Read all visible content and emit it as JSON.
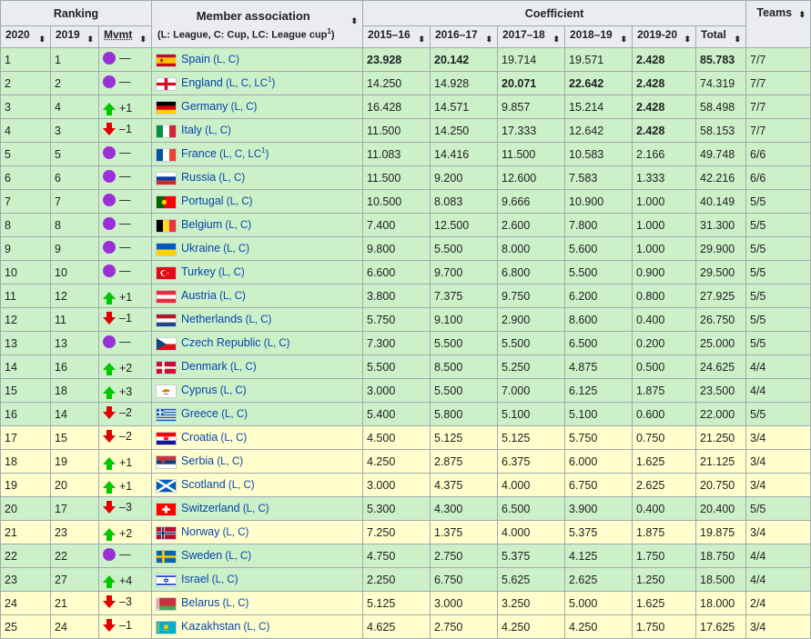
{
  "header": {
    "ranking": "Ranking",
    "member": "Member association",
    "member_sub": "(L: League, C: Cup, LC: League cup",
    "member_sub_sup": "1",
    "member_sub_end": ")",
    "coefficient": "Coefficient",
    "teams": "Teams",
    "col_2020": "2020",
    "col_2019": "2019",
    "col_mvmt": "Mvmt",
    "col_1516": "2015–16",
    "col_1617": "2016–17",
    "col_1718": "2017–18",
    "col_1819": "2018–19",
    "col_1920": "2019-20",
    "col_total": "Total",
    "sort_glyph": "⬍"
  },
  "colors": {
    "green_row": "#ccf0c8",
    "yellow_row": "#fffecc",
    "header_bg": "#eaecf0",
    "link": "#0645ad",
    "up": "#00c800",
    "down": "#e00000",
    "same": "#9b30d9"
  },
  "rows": [
    {
      "r2020": "1",
      "r2019": "1",
      "mv": "same",
      "mvt": "—",
      "flag": "spain",
      "country": "Spain",
      "comp": "(L, C)",
      "sup": "",
      "comp2": "",
      "v1": "23.928",
      "b1": true,
      "v2": "20.142",
      "b2": true,
      "v3": "19.714",
      "b3": false,
      "v4": "19.571",
      "b4": false,
      "v5": "2.428",
      "b5": true,
      "total": "85.783",
      "bt": true,
      "teams": "7/7",
      "color": "green"
    },
    {
      "r2020": "2",
      "r2019": "2",
      "mv": "same",
      "mvt": "—",
      "flag": "england",
      "country": "England",
      "comp": "(L, C, LC",
      "sup": "1",
      "comp2": ")",
      "v1": "14.250",
      "b1": false,
      "v2": "14.928",
      "b2": false,
      "v3": "20.071",
      "b3": true,
      "v4": "22.642",
      "b4": true,
      "v5": "2.428",
      "b5": true,
      "total": "74.319",
      "bt": false,
      "teams": "7/7",
      "color": "green"
    },
    {
      "r2020": "3",
      "r2019": "4",
      "mv": "up",
      "mvt": "+1",
      "flag": "germany",
      "country": "Germany",
      "comp": "(L, C)",
      "sup": "",
      "comp2": "",
      "v1": "16.428",
      "b1": false,
      "v2": "14.571",
      "b2": false,
      "v3": "9.857",
      "b3": false,
      "v4": "15.214",
      "b4": false,
      "v5": "2.428",
      "b5": true,
      "total": "58.498",
      "bt": false,
      "teams": "7/7",
      "color": "green"
    },
    {
      "r2020": "4",
      "r2019": "3",
      "mv": "down",
      "mvt": "–1",
      "flag": "italy",
      "country": "Italy",
      "comp": "(L, C)",
      "sup": "",
      "comp2": "",
      "v1": "11.500",
      "b1": false,
      "v2": "14.250",
      "b2": false,
      "v3": "17.333",
      "b3": false,
      "v4": "12.642",
      "b4": false,
      "v5": "2.428",
      "b5": true,
      "total": "58.153",
      "bt": false,
      "teams": "7/7",
      "color": "green"
    },
    {
      "r2020": "5",
      "r2019": "5",
      "mv": "same",
      "mvt": "—",
      "flag": "france",
      "country": "France",
      "comp": "(L, C, LC",
      "sup": "1",
      "comp2": ")",
      "v1": "11.083",
      "b1": false,
      "v2": "14.416",
      "b2": false,
      "v3": "11.500",
      "b3": false,
      "v4": "10.583",
      "b4": false,
      "v5": "2.166",
      "b5": false,
      "total": "49.748",
      "bt": false,
      "teams": "6/6",
      "color": "green"
    },
    {
      "r2020": "6",
      "r2019": "6",
      "mv": "same",
      "mvt": "—",
      "flag": "russia",
      "country": "Russia",
      "comp": "(L, C)",
      "sup": "",
      "comp2": "",
      "v1": "11.500",
      "b1": false,
      "v2": "9.200",
      "b2": false,
      "v3": "12.600",
      "b3": false,
      "v4": "7.583",
      "b4": false,
      "v5": "1.333",
      "b5": false,
      "total": "42.216",
      "bt": false,
      "teams": "6/6",
      "color": "green"
    },
    {
      "r2020": "7",
      "r2019": "7",
      "mv": "same",
      "mvt": "—",
      "flag": "portugal",
      "country": "Portugal",
      "comp": "(L, C)",
      "sup": "",
      "comp2": "",
      "v1": "10.500",
      "b1": false,
      "v2": "8.083",
      "b2": false,
      "v3": "9.666",
      "b3": false,
      "v4": "10.900",
      "b4": false,
      "v5": "1.000",
      "b5": false,
      "total": "40.149",
      "bt": false,
      "teams": "5/5",
      "color": "green"
    },
    {
      "r2020": "8",
      "r2019": "8",
      "mv": "same",
      "mvt": "—",
      "flag": "belgium",
      "country": "Belgium",
      "comp": "(L, C)",
      "sup": "",
      "comp2": "",
      "v1": "7.400",
      "b1": false,
      "v2": "12.500",
      "b2": false,
      "v3": "2.600",
      "b3": false,
      "v4": "7.800",
      "b4": false,
      "v5": "1.000",
      "b5": false,
      "total": "31.300",
      "bt": false,
      "teams": "5/5",
      "color": "green"
    },
    {
      "r2020": "9",
      "r2019": "9",
      "mv": "same",
      "mvt": "—",
      "flag": "ukraine",
      "country": "Ukraine",
      "comp": "(L, C)",
      "sup": "",
      "comp2": "",
      "v1": "9.800",
      "b1": false,
      "v2": "5.500",
      "b2": false,
      "v3": "8.000",
      "b3": false,
      "v4": "5.600",
      "b4": false,
      "v5": "1.000",
      "b5": false,
      "total": "29.900",
      "bt": false,
      "teams": "5/5",
      "color": "green"
    },
    {
      "r2020": "10",
      "r2019": "10",
      "mv": "same",
      "mvt": "—",
      "flag": "turkey",
      "country": "Turkey",
      "comp": "(L, C)",
      "sup": "",
      "comp2": "",
      "v1": "6.600",
      "b1": false,
      "v2": "9.700",
      "b2": false,
      "v3": "6.800",
      "b3": false,
      "v4": "5.500",
      "b4": false,
      "v5": "0.900",
      "b5": false,
      "total": "29.500",
      "bt": false,
      "teams": "5/5",
      "color": "green"
    },
    {
      "r2020": "11",
      "r2019": "12",
      "mv": "up",
      "mvt": "+1",
      "flag": "austria",
      "country": "Austria",
      "comp": "(L, C)",
      "sup": "",
      "comp2": "",
      "v1": "3.800",
      "b1": false,
      "v2": "7.375",
      "b2": false,
      "v3": "9.750",
      "b3": false,
      "v4": "6.200",
      "b4": false,
      "v5": "0.800",
      "b5": false,
      "total": "27.925",
      "bt": false,
      "teams": "5/5",
      "color": "green"
    },
    {
      "r2020": "12",
      "r2019": "11",
      "mv": "down",
      "mvt": "–1",
      "flag": "netherlands",
      "country": "Netherlands",
      "comp": "(L, C)",
      "sup": "",
      "comp2": "",
      "v1": "5.750",
      "b1": false,
      "v2": "9.100",
      "b2": false,
      "v3": "2.900",
      "b3": false,
      "v4": "8.600",
      "b4": false,
      "v5": "0.400",
      "b5": false,
      "total": "26.750",
      "bt": false,
      "teams": "5/5",
      "color": "green"
    },
    {
      "r2020": "13",
      "r2019": "13",
      "mv": "same",
      "mvt": "—",
      "flag": "czech",
      "country": "Czech Republic",
      "comp": "(L, C)",
      "sup": "",
      "comp2": "",
      "v1": "7.300",
      "b1": false,
      "v2": "5.500",
      "b2": false,
      "v3": "5.500",
      "b3": false,
      "v4": "6.500",
      "b4": false,
      "v5": "0.200",
      "b5": false,
      "total": "25.000",
      "bt": false,
      "teams": "5/5",
      "color": "green"
    },
    {
      "r2020": "14",
      "r2019": "16",
      "mv": "up",
      "mvt": "+2",
      "flag": "denmark",
      "country": "Denmark",
      "comp": "(L, C)",
      "sup": "",
      "comp2": "",
      "v1": "5.500",
      "b1": false,
      "v2": "8.500",
      "b2": false,
      "v3": "5.250",
      "b3": false,
      "v4": "4.875",
      "b4": false,
      "v5": "0.500",
      "b5": false,
      "total": "24.625",
      "bt": false,
      "teams": "4/4",
      "color": "green"
    },
    {
      "r2020": "15",
      "r2019": "18",
      "mv": "up",
      "mvt": "+3",
      "flag": "cyprus",
      "country": "Cyprus",
      "comp": "(L, C)",
      "sup": "",
      "comp2": "",
      "v1": "3.000",
      "b1": false,
      "v2": "5.500",
      "b2": false,
      "v3": "7.000",
      "b3": false,
      "v4": "6.125",
      "b4": false,
      "v5": "1.875",
      "b5": false,
      "total": "23.500",
      "bt": false,
      "teams": "4/4",
      "color": "green"
    },
    {
      "r2020": "16",
      "r2019": "14",
      "mv": "down",
      "mvt": "–2",
      "flag": "greece",
      "country": "Greece",
      "comp": "(L, C)",
      "sup": "",
      "comp2": "",
      "v1": "5.400",
      "b1": false,
      "v2": "5.800",
      "b2": false,
      "v3": "5.100",
      "b3": false,
      "v4": "5.100",
      "b4": false,
      "v5": "0.600",
      "b5": false,
      "total": "22.000",
      "bt": false,
      "teams": "5/5",
      "color": "green"
    },
    {
      "r2020": "17",
      "r2019": "15",
      "mv": "down",
      "mvt": "–2",
      "flag": "croatia",
      "country": "Croatia",
      "comp": "(L, C)",
      "sup": "",
      "comp2": "",
      "v1": "4.500",
      "b1": false,
      "v2": "5.125",
      "b2": false,
      "v3": "5.125",
      "b3": false,
      "v4": "5.750",
      "b4": false,
      "v5": "0.750",
      "b5": false,
      "total": "21.250",
      "bt": false,
      "teams": "3/4",
      "color": "yellow"
    },
    {
      "r2020": "18",
      "r2019": "19",
      "mv": "up",
      "mvt": "+1",
      "flag": "serbia",
      "country": "Serbia",
      "comp": "(L, C)",
      "sup": "",
      "comp2": "",
      "v1": "4.250",
      "b1": false,
      "v2": "2.875",
      "b2": false,
      "v3": "6.375",
      "b3": false,
      "v4": "6.000",
      "b4": false,
      "v5": "1.625",
      "b5": false,
      "total": "21.125",
      "bt": false,
      "teams": "3/4",
      "color": "yellow"
    },
    {
      "r2020": "19",
      "r2019": "20",
      "mv": "up",
      "mvt": "+1",
      "flag": "scotland",
      "country": "Scotland",
      "comp": "(L, C)",
      "sup": "",
      "comp2": "",
      "v1": "3.000",
      "b1": false,
      "v2": "4.375",
      "b2": false,
      "v3": "4.000",
      "b3": false,
      "v4": "6.750",
      "b4": false,
      "v5": "2.625",
      "b5": false,
      "total": "20.750",
      "bt": false,
      "teams": "3/4",
      "color": "yellow"
    },
    {
      "r2020": "20",
      "r2019": "17",
      "mv": "down",
      "mvt": "–3",
      "flag": "switzerland",
      "country": "Switzerland",
      "comp": "(L, C)",
      "sup": "",
      "comp2": "",
      "v1": "5.300",
      "b1": false,
      "v2": "4.300",
      "b2": false,
      "v3": "6.500",
      "b3": false,
      "v4": "3.900",
      "b4": false,
      "v5": "0.400",
      "b5": false,
      "total": "20.400",
      "bt": false,
      "teams": "5/5",
      "color": "green"
    },
    {
      "r2020": "21",
      "r2019": "23",
      "mv": "up",
      "mvt": "+2",
      "flag": "norway",
      "country": "Norway",
      "comp": "(L, C)",
      "sup": "",
      "comp2": "",
      "v1": "7.250",
      "b1": false,
      "v2": "1.375",
      "b2": false,
      "v3": "4.000",
      "b3": false,
      "v4": "5.375",
      "b4": false,
      "v5": "1.875",
      "b5": false,
      "total": "19.875",
      "bt": false,
      "teams": "3/4",
      "color": "yellow"
    },
    {
      "r2020": "22",
      "r2019": "22",
      "mv": "same",
      "mvt": "—",
      "flag": "sweden",
      "country": "Sweden",
      "comp": "(L, C)",
      "sup": "",
      "comp2": "",
      "v1": "4.750",
      "b1": false,
      "v2": "2.750",
      "b2": false,
      "v3": "5.375",
      "b3": false,
      "v4": "4.125",
      "b4": false,
      "v5": "1.750",
      "b5": false,
      "total": "18.750",
      "bt": false,
      "teams": "4/4",
      "color": "green"
    },
    {
      "r2020": "23",
      "r2019": "27",
      "mv": "up",
      "mvt": "+4",
      "flag": "israel",
      "country": "Israel",
      "comp": "(L, C)",
      "sup": "",
      "comp2": "",
      "v1": "2.250",
      "b1": false,
      "v2": "6.750",
      "b2": false,
      "v3": "5.625",
      "b3": false,
      "v4": "2.625",
      "b4": false,
      "v5": "1.250",
      "b5": false,
      "total": "18.500",
      "bt": false,
      "teams": "4/4",
      "color": "green"
    },
    {
      "r2020": "24",
      "r2019": "21",
      "mv": "down",
      "mvt": "–3",
      "flag": "belarus",
      "country": "Belarus",
      "comp": "(L, C)",
      "sup": "",
      "comp2": "",
      "v1": "5.125",
      "b1": false,
      "v2": "3.000",
      "b2": false,
      "v3": "3.250",
      "b3": false,
      "v4": "5.000",
      "b4": false,
      "v5": "1.625",
      "b5": false,
      "total": "18.000",
      "bt": false,
      "teams": "2/4",
      "color": "yellow"
    },
    {
      "r2020": "25",
      "r2019": "24",
      "mv": "down",
      "mvt": "–1",
      "flag": "kazakhstan",
      "country": "Kazakhstan",
      "comp": "(L, C)",
      "sup": "",
      "comp2": "",
      "v1": "4.625",
      "b1": false,
      "v2": "2.750",
      "b2": false,
      "v3": "4.250",
      "b3": false,
      "v4": "4.250",
      "b4": false,
      "v5": "1.750",
      "b5": false,
      "total": "17.625",
      "bt": false,
      "teams": "3/4",
      "color": "yellow"
    }
  ]
}
